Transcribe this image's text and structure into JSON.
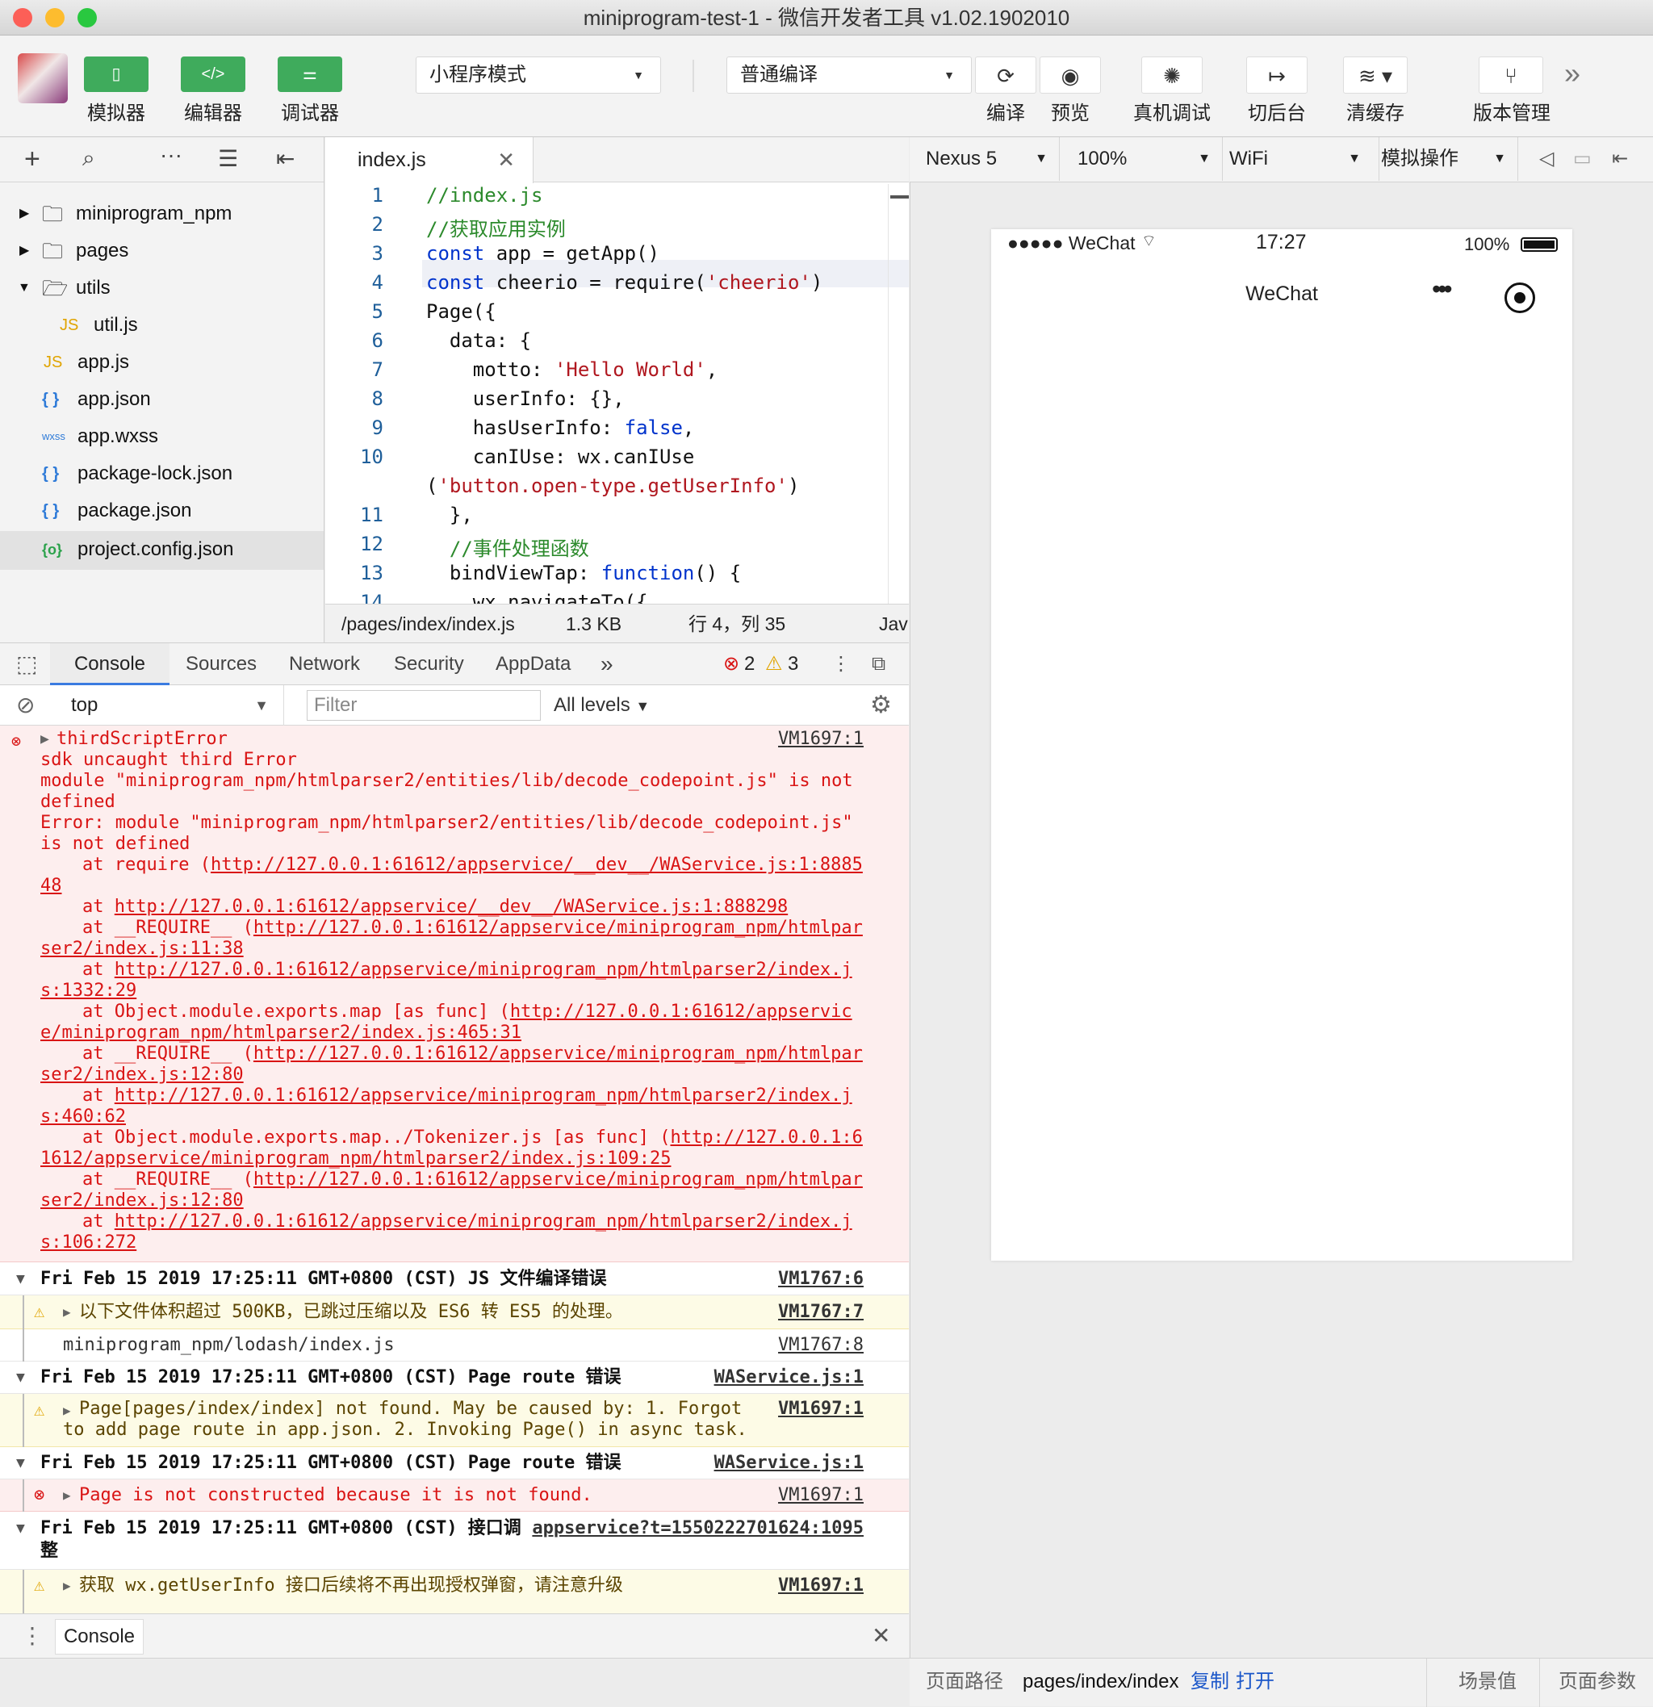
{
  "window": {
    "title": "miniprogram-test-1 - 微信开发者工具 v1.02.1902010"
  },
  "toolbar": {
    "simulator_label": "模拟器",
    "editor_label": "编辑器",
    "debugger_label": "调试器",
    "mode_select": "小程序模式",
    "compile_select": "普通编译",
    "compile_label": "编译",
    "preview_label": "预览",
    "remote_debug_label": "真机调试",
    "background_label": "切后台",
    "clear_cache_label": "清缓存",
    "version_label": "版本管理",
    "more_icon": "»"
  },
  "explorer": {
    "items": [
      {
        "label": "miniprogram_npm",
        "type": "folder"
      },
      {
        "label": "pages",
        "type": "folder"
      },
      {
        "label": "utils",
        "type": "folder-open"
      },
      {
        "label": "util.js",
        "type": "js",
        "badge": "JS"
      },
      {
        "label": "app.js",
        "type": "js",
        "badge": "JS"
      },
      {
        "label": "app.json",
        "type": "json",
        "badge": "{ }"
      },
      {
        "label": "app.wxss",
        "type": "wxss",
        "badge": "wxss"
      },
      {
        "label": "package-lock.json",
        "type": "json",
        "badge": "{ }"
      },
      {
        "label": "package.json",
        "type": "json",
        "badge": "{ }"
      },
      {
        "label": "project.config.json",
        "type": "config",
        "badge": "{o}"
      }
    ]
  },
  "editor": {
    "tab": "index.js",
    "line_numbers": [
      "1",
      "2",
      "3",
      "4",
      "5",
      "6",
      "7",
      "8",
      "9",
      "10",
      "11",
      "12",
      "13",
      "14"
    ],
    "status_path": "/pages/index/index.js",
    "status_size": "1.3 KB",
    "status_pos": "行 4，列 35",
    "status_lang": "Jav"
  },
  "devtools": {
    "tabs": [
      "Console",
      "Sources",
      "Network",
      "Security",
      "AppData"
    ],
    "more": "»",
    "error_count": "2",
    "warn_count": "3",
    "context": "top",
    "filter_placeholder": "Filter",
    "levels": "All levels",
    "drawer_tab": "Console"
  },
  "console": {
    "error1": {
      "head": "thirdScriptError",
      "source": "VM1697:1",
      "l1": "sdk uncaught third Error",
      "l2": "module \"miniprogram_npm/htmlparser2/entities/lib/decode_codepoint.js\" is not",
      "l3": "defined",
      "l4": "Error: module \"miniprogram_npm/htmlparser2/entities/lib/decode_codepoint.js\"",
      "l5": "is not defined",
      "l6a": "at require (",
      "l6b": "http://127.0.0.1:61612/appservice/__dev__/WAService.js:1:8885",
      "l7": "48",
      "l8a": "at ",
      "l8b": "http://127.0.0.1:61612/appservice/__dev__/WAService.js:1:888298",
      "l9a": "at __REQUIRE__ (",
      "l9b": "http://127.0.0.1:61612/appservice/miniprogram_npm/htmlpar",
      "l10": "ser2/index.js:11:38",
      "l11a": "at ",
      "l11b": "http://127.0.0.1:61612/appservice/miniprogram_npm/htmlparser2/index.j",
      "l12": "s:1332:29",
      "l13a": "at Object.module.exports.map [as func] (",
      "l13b": "http://127.0.0.1:61612/appservic",
      "l14": "e/miniprogram_npm/htmlparser2/index.js:465:31",
      "l15a": "at __REQUIRE__ (",
      "l15b": "http://127.0.0.1:61612/appservice/miniprogram_npm/htmlpar",
      "l16": "ser2/index.js:12:80",
      "l17a": "at ",
      "l17b": "http://127.0.0.1:61612/appservice/miniprogram_npm/htmlparser2/index.j",
      "l18": "s:460:62",
      "l19a": "at Object.module.exports.map../Tokenizer.js [as func] (",
      "l19b": "http://127.0.0.1:6",
      "l20": "1612/appservice/miniprogram_npm/htmlparser2/index.js:109:25",
      "l21a": "at __REQUIRE__ (",
      "l21b": "http://127.0.0.1:61612/appservice/miniprogram_npm/htmlpar",
      "l22": "ser2/index.js:12:80",
      "l23a": "at ",
      "l23b": "http://127.0.0.1:61612/appservice/miniprogram_npm/htmlparser2/index.j",
      "l24": "s:106:272"
    },
    "group1": {
      "text": "Fri Feb 15 2019 17:25:11 GMT+0800 (CST) JS 文件编译错误",
      "source": "VM1767:6"
    },
    "warn1": {
      "text": "以下文件体积超过 500KB，已跳过压缩以及 ES6 转 ES5 的处理。",
      "source": "VM1767:7"
    },
    "plain1": {
      "text": "miniprogram_npm/lodash/index.js",
      "source": "VM1767:8"
    },
    "group2": {
      "text": "Fri Feb 15 2019 17:25:11 GMT+0800 (CST) Page route 错误",
      "source": "WAService.js:1"
    },
    "warn2": {
      "l1": "Page[pages/index/index] not found. May be caused by: 1. Forgot",
      "l2": "to add page route in app.json. 2. Invoking Page() in async task.",
      "source": "VM1697:1"
    },
    "group3": {
      "text": "Fri Feb 15 2019 17:25:11 GMT+0800 (CST) Page route 错误",
      "source": "WAService.js:1"
    },
    "error2": {
      "text": "Page is not constructed because it is not found.",
      "source": "VM1697:1"
    },
    "group4": {
      "l1": "Fri Feb 15 2019 17:25:11 GMT+0800 (CST) 接口调",
      "l2": "整",
      "source": "appservice?t=1550222701624:1095"
    },
    "warn3": {
      "text": "获取 wx.getUserInfo 接口后续将不再出现授权弹窗，请注意升级",
      "source": "VM1697:1"
    }
  },
  "simulator": {
    "device": "Nexus 5",
    "zoom": "100%",
    "network": "WiFi",
    "ops": "模拟操作",
    "status_carrier": "●●●●● WeChat",
    "status_time": "17:27",
    "status_battery": "100%",
    "nav_title": "WeChat"
  },
  "bottom": {
    "path_label": "页面路径",
    "path_value": "pages/index/index",
    "copy": "复制",
    "open": "打开",
    "scene": "场景值",
    "params": "页面参数"
  },
  "colors": {
    "accent_green": "#3fab5c",
    "error_red": "#d91414",
    "link_blue": "#1a56c9"
  }
}
